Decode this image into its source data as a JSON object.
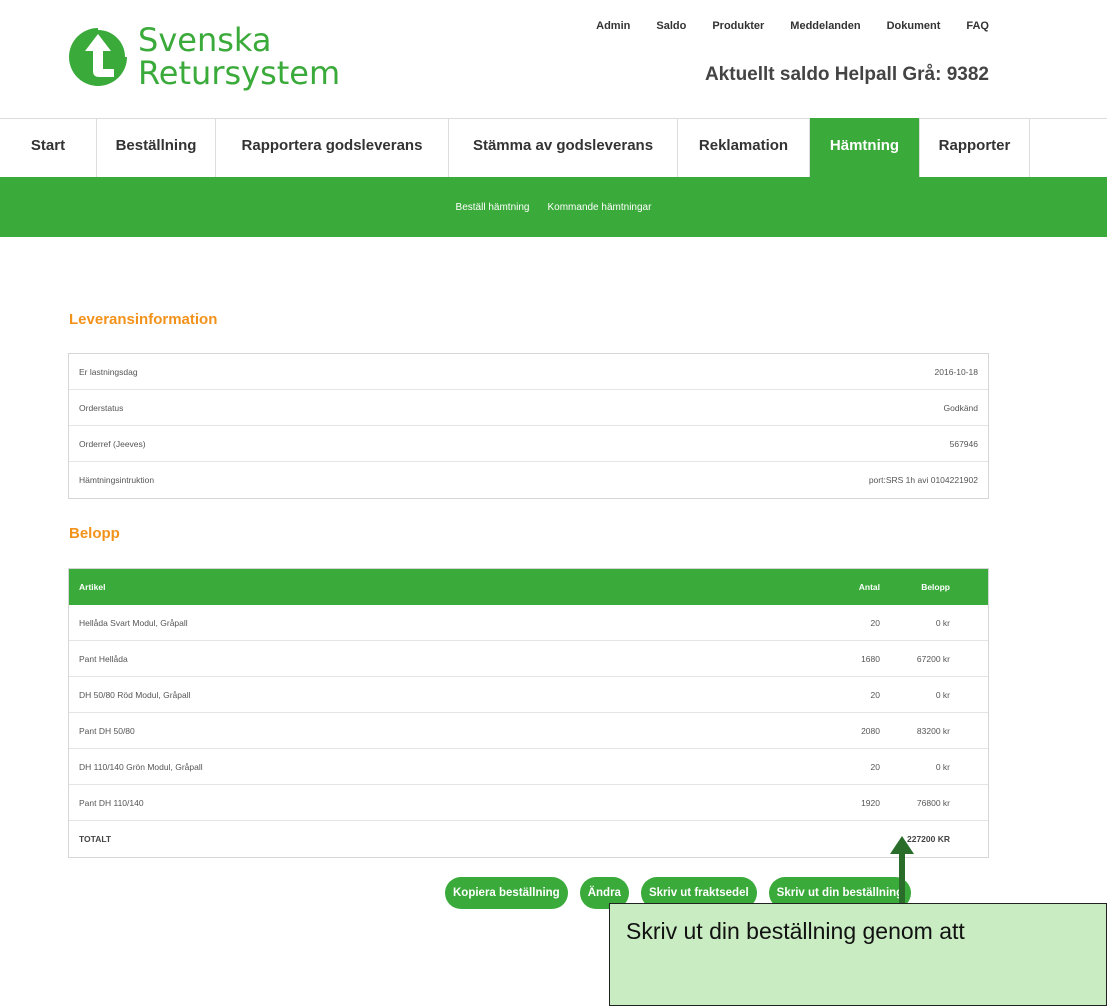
{
  "logo": {
    "line1": "Svenska",
    "line2": "Retursystem"
  },
  "toplinks": [
    "Admin",
    "Saldo",
    "Produkter",
    "Meddelanden",
    "Dokument",
    "FAQ"
  ],
  "saldo_text": "Aktuellt saldo Helpall Grå: 9382",
  "main_nav": [
    {
      "label": "Start",
      "width": 0
    },
    {
      "label": "Beställning"
    },
    {
      "label": "Rapportera godsleverans"
    },
    {
      "label": "Stämma av godsleverans"
    },
    {
      "label": "Reklamation"
    },
    {
      "label": "Hämtning",
      "active": true
    },
    {
      "label": "Rapporter"
    }
  ],
  "sub_nav": [
    "Beställ hämtning",
    "Kommande hämtningar"
  ],
  "delivery": {
    "title": "Leveransinformation",
    "rows": [
      {
        "label": "Er lastningsdag",
        "value": "2016-10-18"
      },
      {
        "label": "Orderstatus",
        "value": "Godkänd"
      },
      {
        "label": "Orderref (Jeeves)",
        "value": "567946"
      },
      {
        "label": "Hämtningsintruktion",
        "value": "port:SRS 1h avi 0104221902"
      }
    ]
  },
  "amounts": {
    "title": "Belopp",
    "headers": {
      "article": "Artikel",
      "qty": "Antal",
      "amount": "Belopp"
    },
    "rows": [
      {
        "article": "Hellåda Svart Modul, Gråpall",
        "qty": "20",
        "amount": "0 kr"
      },
      {
        "article": "Pant Hellåda",
        "qty": "1680",
        "amount": "67200 kr"
      },
      {
        "article": "DH 50/80 Röd Modul, Gråpall",
        "qty": "20",
        "amount": "0 kr"
      },
      {
        "article": "Pant DH 50/80",
        "qty": "2080",
        "amount": "83200 kr"
      },
      {
        "article": "DH 110/140 Grön Modul, Gråpall",
        "qty": "20",
        "amount": "0 kr"
      },
      {
        "article": "Pant DH 110/140",
        "qty": "1920",
        "amount": "76800 kr"
      }
    ],
    "total_label": "TOTALT",
    "total_value": "227200 KR"
  },
  "buttons": {
    "copy": "Kopiera beställning",
    "edit": "Ändra",
    "print_freight": "Skriv ut fraktsedel",
    "print_order": "Skriv ut din beställning"
  },
  "callout_text": "Skriv ut din beställning genom att",
  "colors": {
    "brand_green": "#3aaa3a",
    "heading_orange": "#f2921b"
  }
}
